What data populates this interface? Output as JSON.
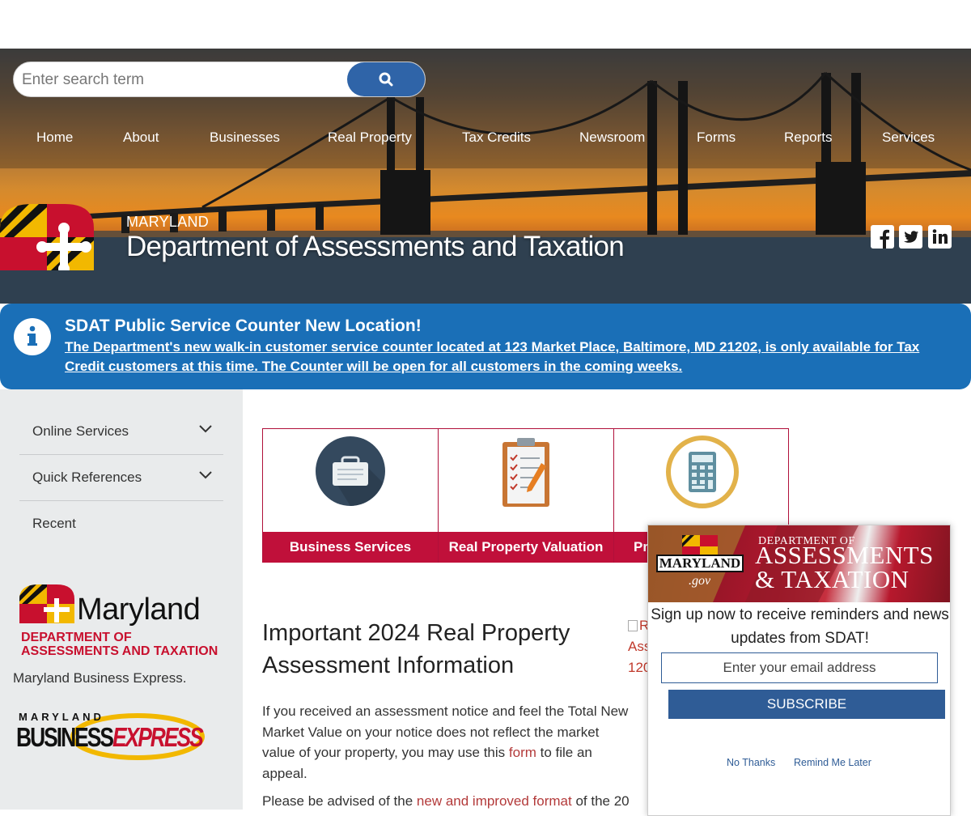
{
  "search": {
    "placeholder": "Enter search term",
    "button_icon": "search-icon"
  },
  "nav": [
    "Home",
    "About",
    "Businesses",
    "Real Property",
    "Tax Credits",
    "Newsroom",
    "Forms",
    "Reports",
    "Services"
  ],
  "brand": {
    "state": "MARYLAND",
    "title": "Department of Assessments and Taxation"
  },
  "social": [
    "facebook-icon",
    "twitter-icon",
    "linkedin-icon"
  ],
  "alert": {
    "title": "SDAT Public Service Counter New Location!",
    "link": "The Department's new walk-in customer service counter located at 123 Market Place, Baltimore, MD 21202, is only available for Tax Credit customers at this time. The Counter will be open for all customers in the coming weeks."
  },
  "sidebar": {
    "items": [
      {
        "label": "Online Services",
        "expandable": true
      },
      {
        "label": "Quick References",
        "expandable": true
      },
      {
        "label": "Recent",
        "expandable": false
      }
    ],
    "md_logo": {
      "word": "Maryland",
      "dept_line1": "DEPARTMENT OF",
      "dept_line2": "ASSESSMENTS AND TAXATION"
    },
    "mbe_text": "Maryland Business Express.",
    "mbe_logo": {
      "top": "MARYLAND",
      "business": "BUSINESS",
      "express": "EXPRESS"
    }
  },
  "tiles": [
    {
      "label": "Business Services",
      "icon": "briefcase-icon"
    },
    {
      "label": "Real Property Valuation",
      "icon": "clipboard-icon"
    },
    {
      "label": "Pr",
      "icon": "calculator-icon"
    }
  ],
  "main": {
    "heading": "Important 2024 Real Property Assessment Information",
    "broken_image_text": [
      "R",
      "Ass",
      "120"
    ],
    "para1_before": "If you received an assessment notice and feel the Total New Market Value on your notice does not reflect the market value of your property, you may use this ",
    "para1_link": "form",
    "para1_after": " to file an appeal.",
    "para2_before": "Please be advised of the ",
    "para2_link": "new and improved format",
    "para2_after": " of the 20"
  },
  "popup": {
    "banner_md": "MARYLAND",
    "banner_gov": ".gov",
    "banner_dept": "DEPARTMENT OF",
    "banner_line1": "ASSESSMENTS",
    "banner_line2": "& TAXATION",
    "message": "Sign up now to receive reminders and news updates from SDAT!",
    "email_placeholder": "Enter your email address",
    "subscribe": "SUBSCRIBE",
    "no_thanks": "No Thanks",
    "remind": "Remind Me Later"
  },
  "colors": {
    "alert_blue": "#1a6fb7",
    "tile_red": "#c0103a",
    "popup_blue": "#2f5c96",
    "sidebar_gray": "#e9ebec"
  }
}
